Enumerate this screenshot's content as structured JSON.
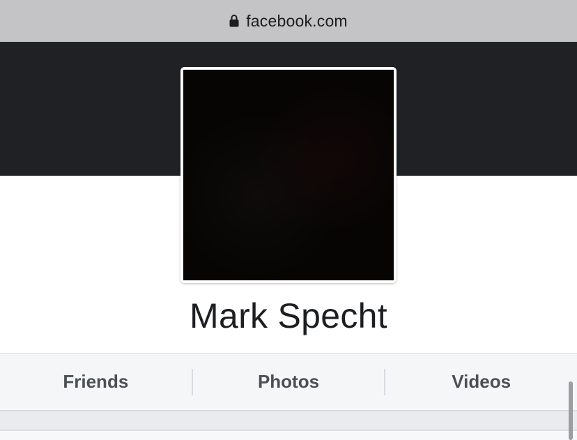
{
  "browser": {
    "url": "facebook.com",
    "lock_icon": "lock-icon"
  },
  "profile": {
    "cover_color": "#202124",
    "name": "Mark Specht"
  },
  "tabs": [
    {
      "label": "Friends"
    },
    {
      "label": "Photos"
    },
    {
      "label": "Videos"
    }
  ],
  "colors": {
    "url_bar": "#c4c4c6",
    "tab_text": "#4b4f56",
    "name_text": "#1c1e21"
  }
}
